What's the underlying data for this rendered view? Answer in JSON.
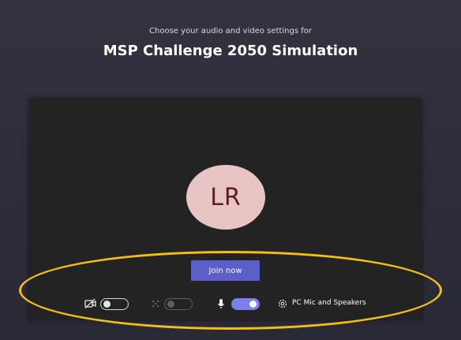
{
  "header": {
    "subtitle": "Choose your audio and video settings for",
    "title": "MSP Challenge 2050 Simulation"
  },
  "avatar": {
    "initials": "LR"
  },
  "join_button": {
    "label": "Join now"
  },
  "controls": {
    "camera_toggle": {
      "state": "off",
      "icon": "video-off-icon"
    },
    "background_toggle": {
      "state": "off",
      "enabled": false,
      "icon": "background-effects-icon"
    },
    "mic_toggle": {
      "state": "on",
      "icon": "microphone-icon"
    },
    "device_settings": {
      "icon": "gear-icon",
      "label": "PC Mic and Speakers"
    }
  },
  "colors": {
    "background": "#2d2c3c",
    "preview": "#232323",
    "avatar_bg": "#e8c4c4",
    "avatar_text": "#5b1e27",
    "accent": "#5b5fc7",
    "toggle_on": "#7c80ea",
    "highlight": "#f4bd17"
  }
}
